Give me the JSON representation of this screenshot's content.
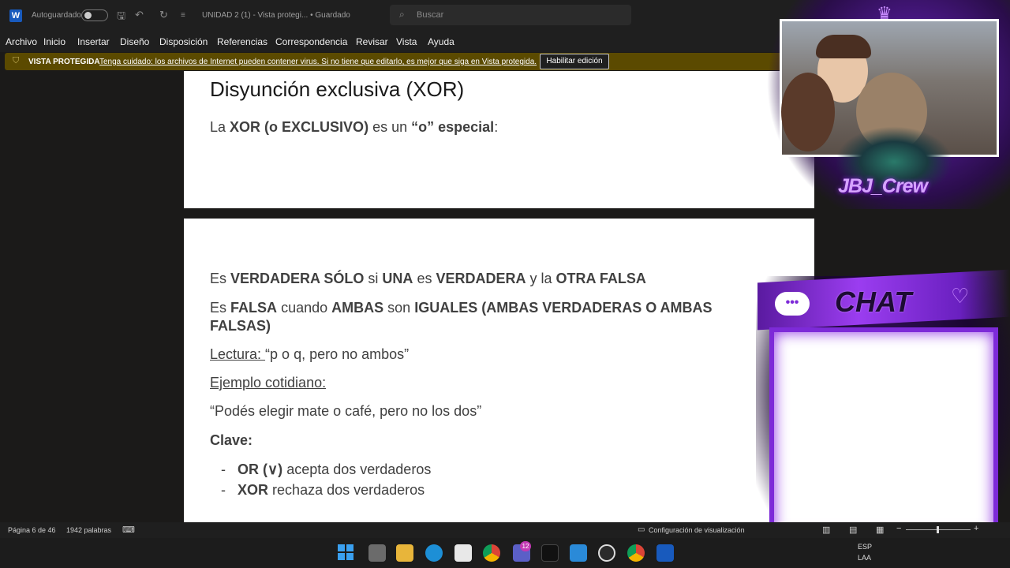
{
  "titlebar": {
    "app_icon_letter": "W",
    "autosave_label": "Autoguardado",
    "doc_title": "UNIDAD 2 (1)  -  Vista protegi...  •  Guardado",
    "search_placeholder": "Buscar"
  },
  "menu": [
    "Archivo",
    "Inicio",
    "Insertar",
    "Diseño",
    "Disposición",
    "Referencias",
    "Correspondencia",
    "Revisar",
    "Vista",
    "Ayuda"
  ],
  "protected_view": {
    "label": "VISTA PROTEGIDA",
    "message": "Tenga cuidado: los archivos de Internet pueden contener virus. Si no tiene que editarlo, es mejor que siga en Vista protegida.",
    "button": "Habilitar edición"
  },
  "document": {
    "heading": "Disyunción exclusiva (XOR)",
    "intro_prefix": "La",
    "intro_bold": "XOR (o EXCLUSIVO)",
    "intro_mid": "es un",
    "intro_bold2": "“o” especial",
    "intro_suffix": ":",
    "line1": [
      "Es",
      "VERDADERA SÓLO",
      "si",
      "UNA",
      "es",
      "VERDADERA",
      "y la",
      "OTRA FALSA"
    ],
    "line2a": [
      "Es",
      "FALSA",
      "cuando",
      "AMBAS",
      "son",
      "IGUALES (AMBAS VERDADERAS O AMBAS"
    ],
    "line2b": "FALSAS)",
    "lectura_label": "Lectura: ",
    "lectura_text": "“p o q, pero no ambos”",
    "ejemplo_label": "Ejemplo cotidiano:",
    "ejemplo_text": "“Podés elegir mate o café, pero no los dos”",
    "clave_label": "Clave:",
    "bullets": [
      {
        "dash": "-",
        "bold": "OR (∨)",
        "text": "acepta dos verdaderos"
      },
      {
        "dash": "-",
        "bold": "XOR",
        "text": "rechaza dos verdaderos"
      }
    ]
  },
  "overlay": {
    "crew_text": "JBJ_Crew",
    "chat_text": "CHAT",
    "chat_bubble": "•••"
  },
  "statusbar": {
    "page": "Página 6 de 46",
    "words": "1942 palabras",
    "view_config": "Configuración de visualización"
  },
  "taskbar": {
    "badge_count": "12",
    "lang_top": "ESP",
    "lang_bottom": "LAA"
  },
  "colors": {
    "word_blue": "#185abd",
    "protected_bar": "#5b4a00",
    "accent_purple": "#7d2ad8"
  }
}
